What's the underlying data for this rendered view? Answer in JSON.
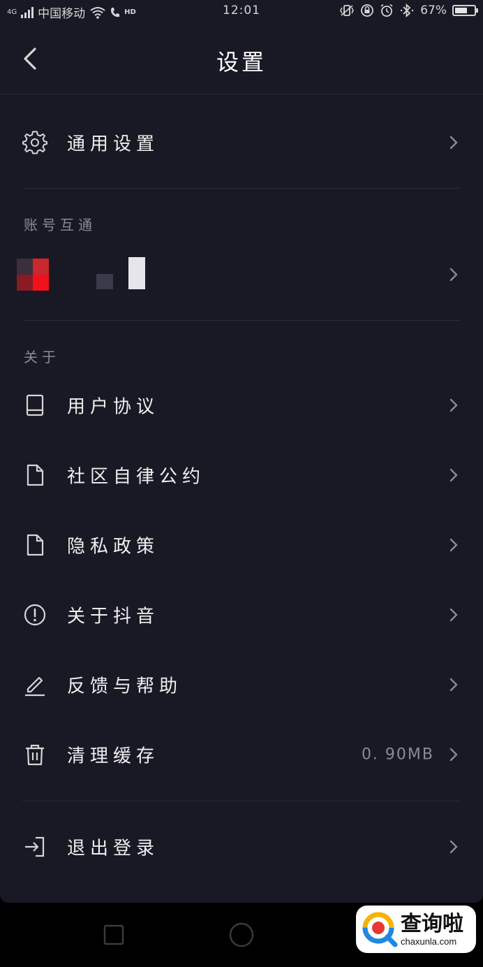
{
  "status_bar": {
    "network": "4G",
    "carrier": "中国移动",
    "volte": "HD",
    "time": "12:01",
    "battery": "67%",
    "battery_level": 0.67
  },
  "header": {
    "title": "设置"
  },
  "general": {
    "label": "通用设置"
  },
  "account_section": {
    "title": "账号互通"
  },
  "about_section": {
    "title": "关于",
    "items": [
      {
        "label": "用户协议",
        "icon": "book-icon"
      },
      {
        "label": "社区自律公约",
        "icon": "document-icon"
      },
      {
        "label": "隐私政策",
        "icon": "document-icon"
      },
      {
        "label": "关于抖音",
        "icon": "info-circle-icon"
      },
      {
        "label": "反馈与帮助",
        "icon": "pencil-icon"
      },
      {
        "label": "清理缓存",
        "icon": "trash-icon",
        "value": "0. 90MB"
      }
    ]
  },
  "logout": {
    "label": "退出登录",
    "icon": "logout-icon"
  },
  "watermark": {
    "cn": "查询啦",
    "en": "chaxunla.com"
  },
  "colors": {
    "background": "#181924",
    "divider": "#2a2b36",
    "secondary_text": "#8a8b93"
  }
}
